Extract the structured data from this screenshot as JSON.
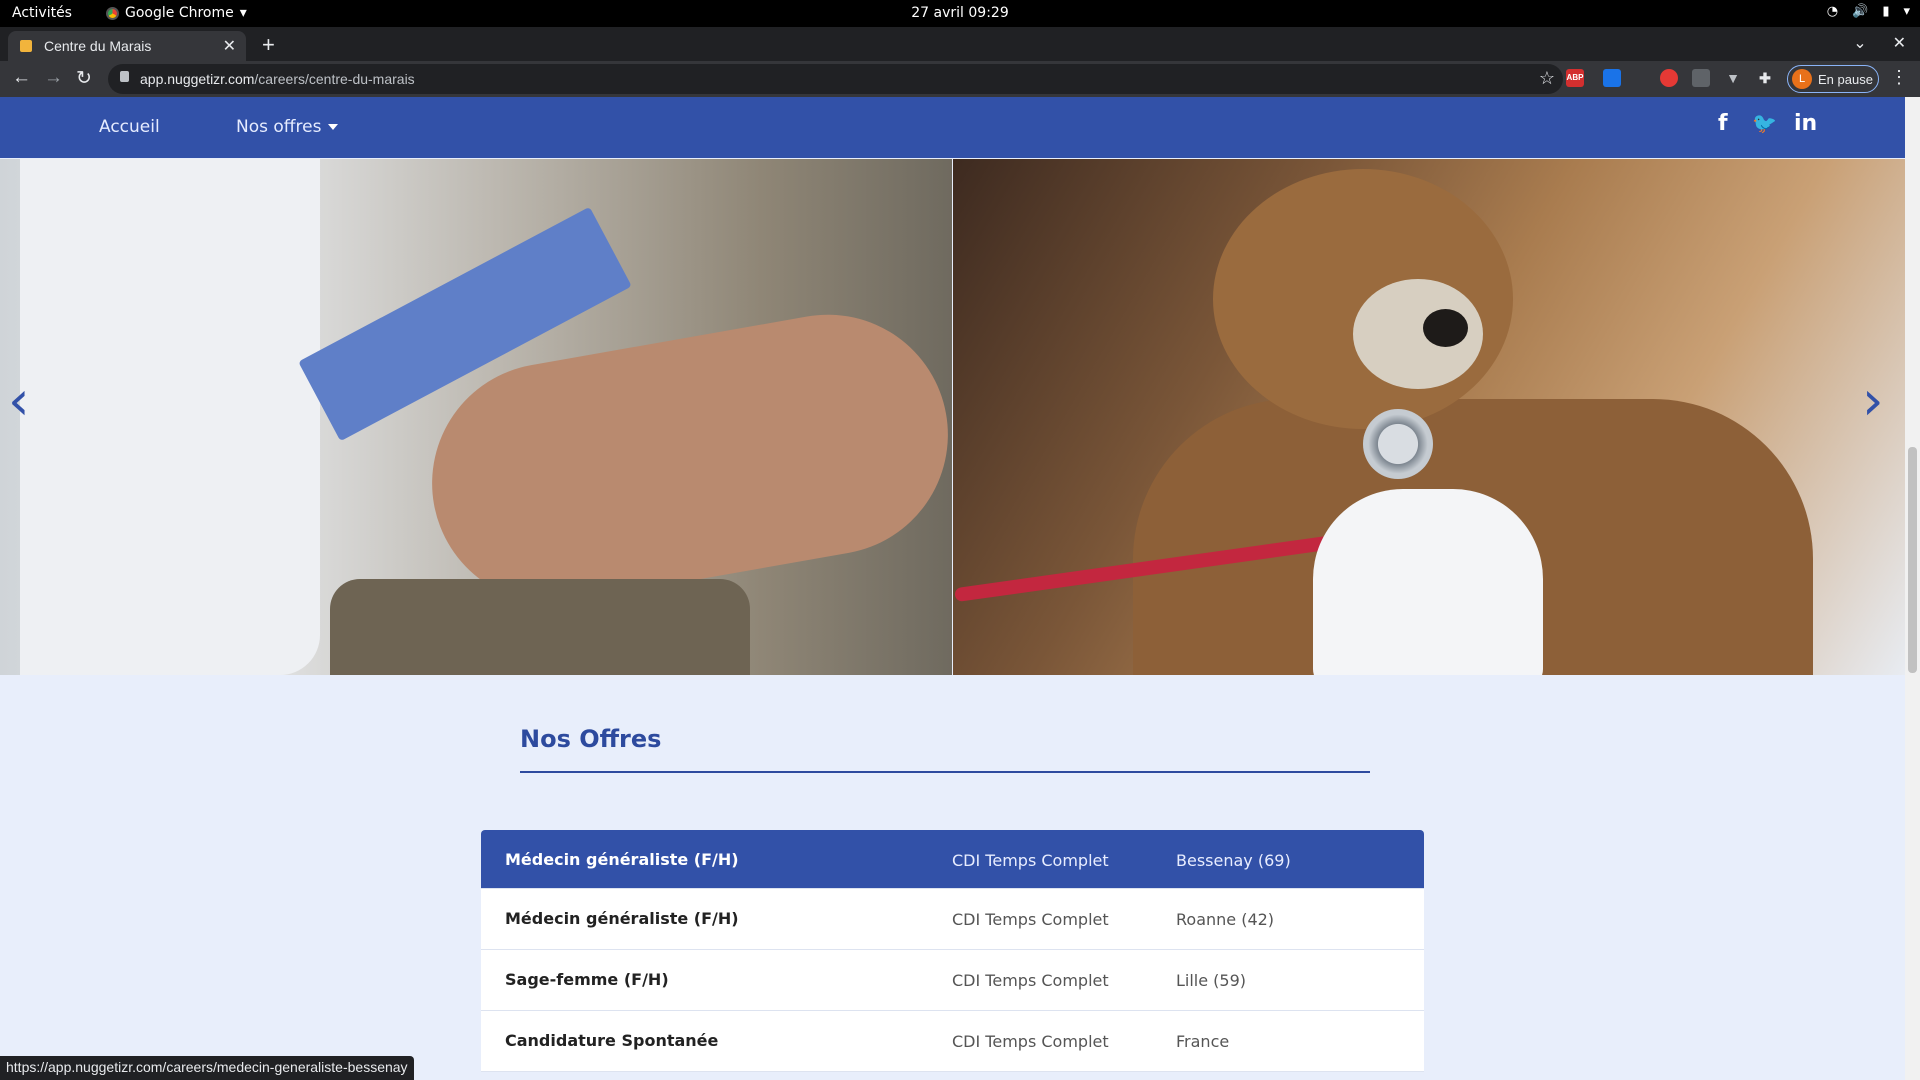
{
  "system": {
    "activities": "Activités",
    "app_name": "Google Chrome",
    "clock": "27 avril  09:29"
  },
  "browser": {
    "tab_title": "Centre du Marais",
    "url_host": "app.nuggetizr.com",
    "url_path": "/careers/centre-du-marais",
    "profile_initial": "L",
    "profile_label": "En pause",
    "extension_abp": "ABP",
    "status_url": "https://app.nuggetizr.com/careers/medecin-generaliste-bessenay"
  },
  "site_nav": {
    "home": "Accueil",
    "offers": "Nos offres",
    "social": {
      "facebook": "f",
      "twitter": "🐦",
      "linkedin": "in"
    }
  },
  "section": {
    "title": "Nos Offres"
  },
  "offers": [
    {
      "title": "Médecin généraliste (F/H)",
      "type": "CDI Temps Complet",
      "location": "Bessenay (69)"
    },
    {
      "title": "Médecin généraliste (F/H)",
      "type": "CDI Temps Complet",
      "location": "Roanne (42)"
    },
    {
      "title": "Sage-femme (F/H)",
      "type": "CDI Temps Complet",
      "location": "Lille (59)"
    },
    {
      "title": "Candidature Spontanée",
      "type": "CDI Temps Complet",
      "location": "France"
    }
  ],
  "colors": {
    "brand": "#3251a8",
    "page_bg": "#e8eefb"
  }
}
